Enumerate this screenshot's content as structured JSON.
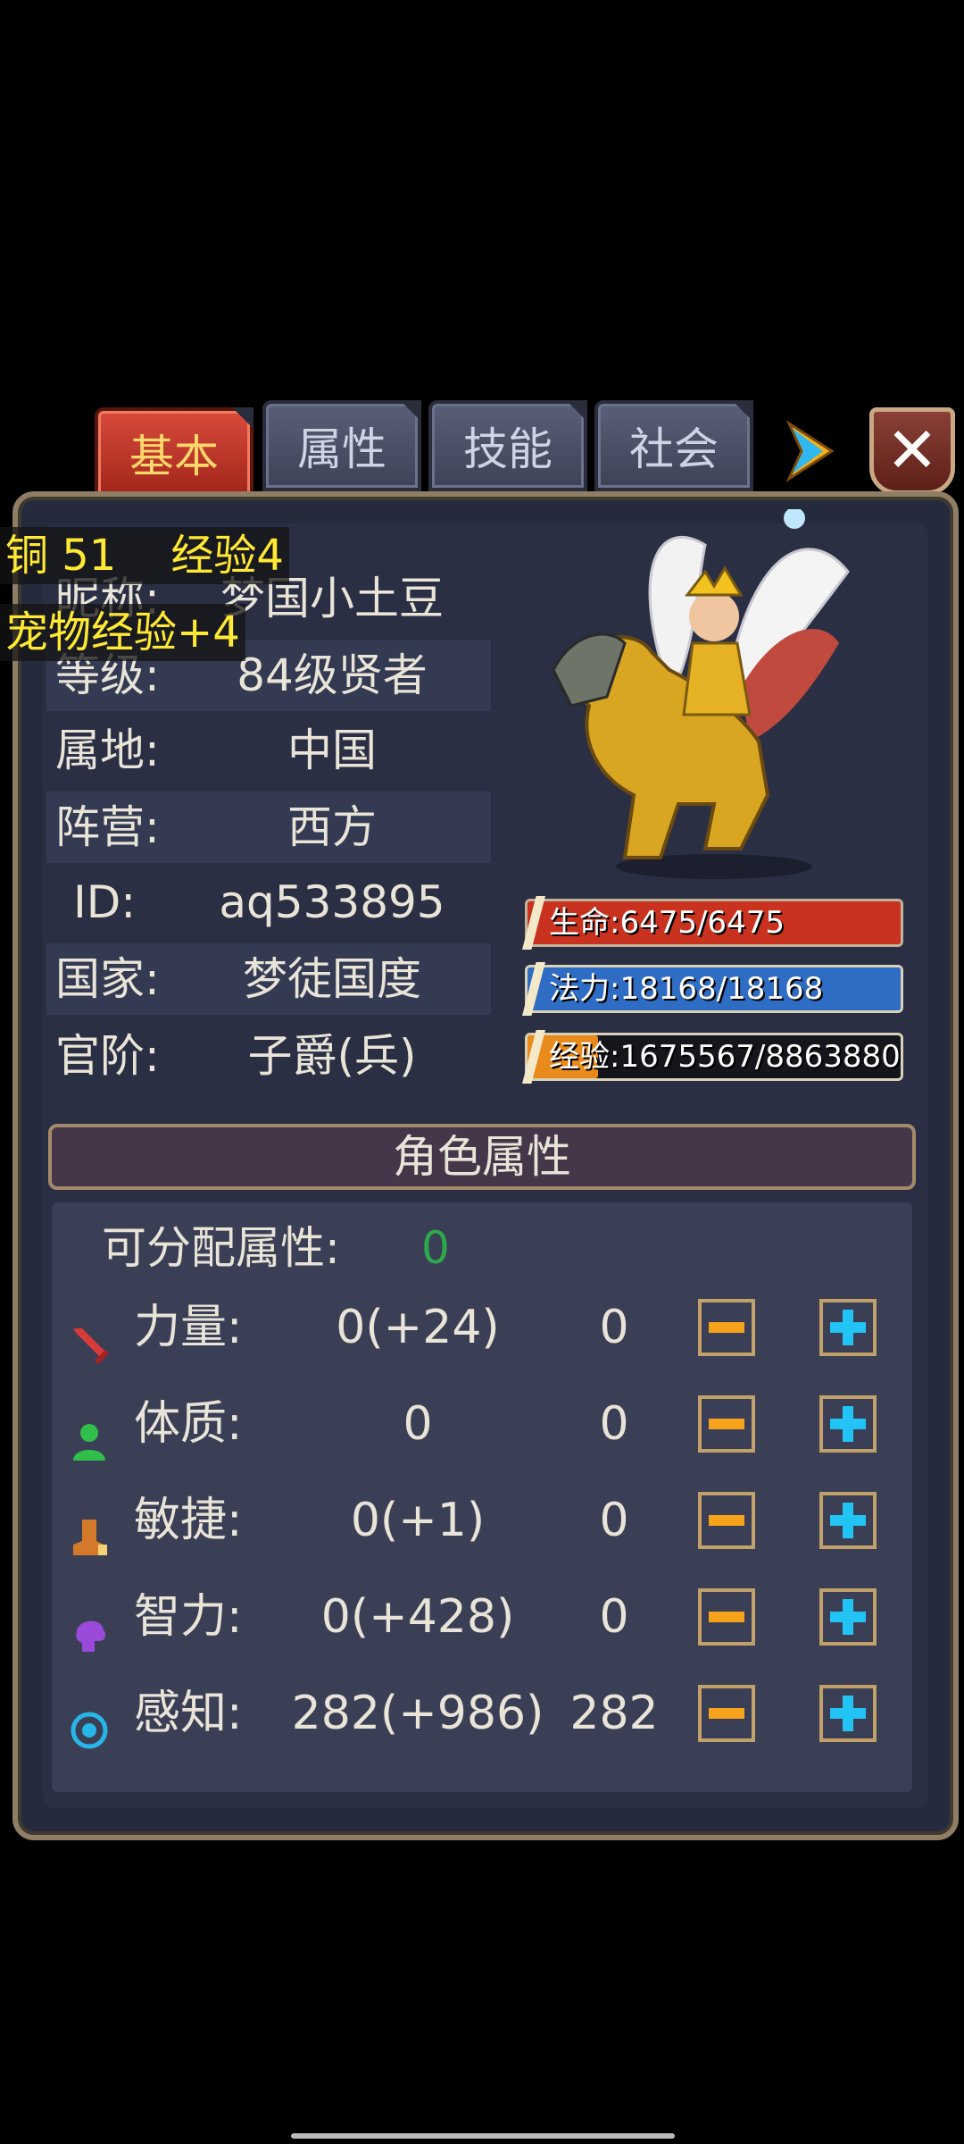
{
  "tabs": [
    {
      "label": "基本",
      "active": true
    },
    {
      "label": "属性",
      "active": false
    },
    {
      "label": "技能",
      "active": false
    },
    {
      "label": "社会",
      "active": false
    }
  ],
  "hud": {
    "line1": "铜 51    经验4",
    "line2": "宠物经验+4"
  },
  "info": {
    "nickname": {
      "label": "昵称:",
      "value": "梦国小土豆"
    },
    "level": {
      "label": "等级:",
      "value": "84级贤者"
    },
    "region": {
      "label": "属地:",
      "value": "中国"
    },
    "camp": {
      "label": "阵营:",
      "value": "西方"
    },
    "id": {
      "label": "ID:",
      "value": "aq533895"
    },
    "country": {
      "label": "国家:",
      "value": "梦徒国度"
    },
    "rank": {
      "label": "官阶:",
      "value": "子爵(兵)"
    }
  },
  "bars": {
    "hp": {
      "text": "生命:6475/6475",
      "fraction": 1.0,
      "color": "#c8321e"
    },
    "mp": {
      "text": "法力:18168/18168",
      "fraction": 1.0,
      "color": "#2f6cc4"
    },
    "exp": {
      "text": "经验:1675567/8863880",
      "fraction": 0.189,
      "color": "#e88a1c"
    }
  },
  "attributes": {
    "title": "角色属性",
    "available_label": "可分配属性:",
    "available_value": "0",
    "rows": [
      {
        "icon": "sword-icon",
        "label": "力量:",
        "value": "0(+24)",
        "alloc": "0",
        "color": "#d93a3a"
      },
      {
        "icon": "person-icon",
        "label": "体质:",
        "value": "0",
        "alloc": "0",
        "color": "#2fbf4a"
      },
      {
        "icon": "boot-icon",
        "label": "敏捷:",
        "value": "0(+1)",
        "alloc": "0",
        "color": "#d27a2a"
      },
      {
        "icon": "brain-icon",
        "label": "智力:",
        "value": "0(+428)",
        "alloc": "0",
        "color": "#9a4ad8"
      },
      {
        "icon": "eye-ring-icon",
        "label": "感知:",
        "value": "282(+986)",
        "alloc": "282",
        "color": "#27b6e8"
      }
    ]
  }
}
